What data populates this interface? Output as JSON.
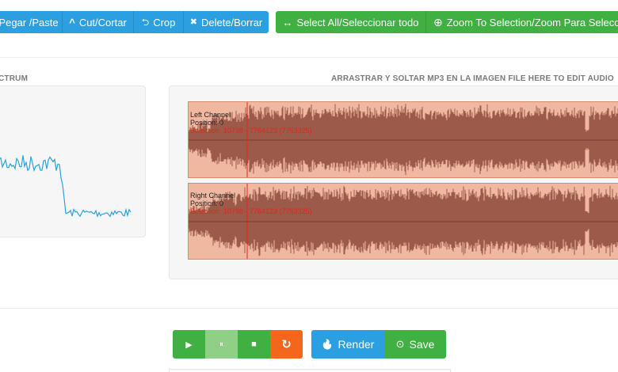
{
  "toolbar": {
    "edit_buttons": [
      {
        "label": "Pegar /Paste",
        "icon": "paste-icon"
      },
      {
        "label": "Cut/Cortar",
        "icon": "caret-up-icon",
        "glyph": "^"
      },
      {
        "label": "Crop",
        "icon": "crop-icon",
        "glyph": "⮌"
      },
      {
        "label": "Delete/Borrar",
        "icon": "close-icon",
        "glyph": "✖"
      }
    ],
    "select_buttons": [
      {
        "label": "Select All/Seleccionar todo",
        "icon": "arrows-horizontal-icon",
        "glyph": "↔"
      },
      {
        "label": "Zoom To Selection/Zoom Para Selecci",
        "icon": "plus-circle-icon",
        "glyph": "⊕"
      }
    ]
  },
  "spectrum": {
    "heading": "CTRUM"
  },
  "waveform": {
    "heading": "ARRASTRAR Y SOLTAR MP3 EN LA IMAGEN FILE HERE TO EDIT AUDIO",
    "channels": [
      {
        "name": "Left Channel",
        "position": "Position: 0",
        "selection": "Selection: 10798 - 7764123 (7753325)"
      },
      {
        "name": "Right Channel",
        "position": "Position: 0",
        "selection": "Selection: 10798 - 7764123 (7753325)"
      }
    ],
    "colors": {
      "background": "#f0b8a0",
      "wave": "#9c5a4b",
      "playhead": "#e3261a"
    }
  },
  "transport": {
    "play": {
      "icon": "play-icon",
      "glyph": "▶"
    },
    "pause": {
      "icon": "pause-icon",
      "glyph": "⏸"
    },
    "stop": {
      "icon": "stop-icon",
      "glyph": "■"
    },
    "loop": {
      "icon": "refresh-icon",
      "glyph": "↻"
    },
    "render": {
      "label": "Render",
      "icon": "fire-icon",
      "glyph": "🔥"
    },
    "save": {
      "label": "Save",
      "icon": "save-icon",
      "glyph": "⊙"
    }
  },
  "colors": {
    "blue": "#2b9fe0",
    "green": "#3fb041",
    "orange": "#f4661b"
  }
}
